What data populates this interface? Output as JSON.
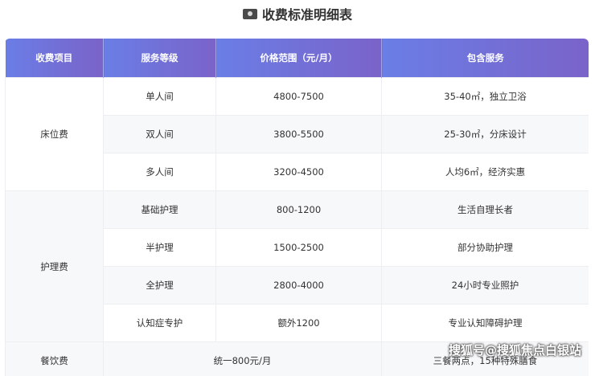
{
  "title": "收费标准明细表",
  "header": [
    "收费项目",
    "服务等级",
    "价格范围（元/月）",
    "包含服务"
  ],
  "bed": {
    "category": "床位费",
    "rows": [
      {
        "level": "单人间",
        "price": "4800-7500",
        "service": "35-40㎡，独立卫浴"
      },
      {
        "level": "双人间",
        "price": "3800-5500",
        "service": "25-30㎡，分床设计"
      },
      {
        "level": "多人间",
        "price": "3200-4500",
        "service": "人均6㎡，经济实惠"
      }
    ]
  },
  "care": {
    "category": "护理费",
    "rows": [
      {
        "level": "基础护理",
        "price": "800-1200",
        "service": "生活自理长者"
      },
      {
        "level": "半护理",
        "price": "1500-2500",
        "service": "部分协助护理"
      },
      {
        "level": "全护理",
        "price": "2800-4000",
        "service": "24小时专业照护"
      },
      {
        "level": "认知症专护",
        "price": "额外1200",
        "service": "专业认知障碍护理"
      }
    ]
  },
  "meal": {
    "category": "餐饮费",
    "price": "统一800元/月",
    "service": "三餐两点，15种特殊膳食"
  },
  "watermark": "搜狐号@搜狐焦点白银站"
}
